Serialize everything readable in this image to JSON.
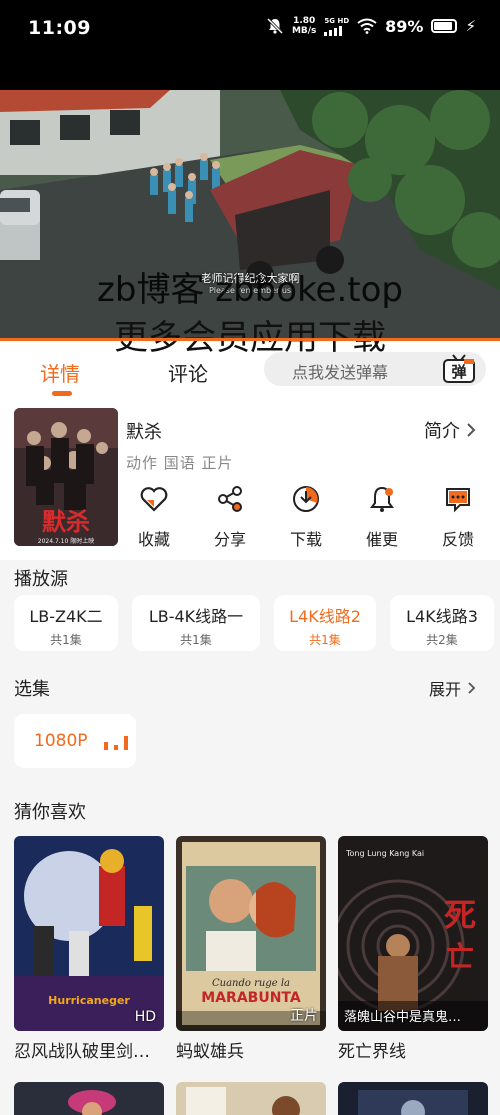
{
  "status_bar": {
    "time": "11:09",
    "net_speed": "1.80",
    "net_unit": "MB/s",
    "net_type": "5G HD",
    "battery": "89%"
  },
  "video": {
    "watermark_line1": "zb博客 zbboke.top",
    "watermark_line2": "更多会员应用下载",
    "subtitle_cn": "老师记得纪念大家啊",
    "subtitle_en": "Please remember us"
  },
  "tabs": [
    {
      "label": "详情"
    },
    {
      "label": "评论"
    }
  ],
  "danmu": {
    "placeholder": "点我发送弹幕",
    "button_label": "弹"
  },
  "movie": {
    "title": "默杀",
    "tags": "动作 国语 正片",
    "intro_label": "简介",
    "poster_text": "默杀",
    "poster_sub": "2024.7.10 限时上映"
  },
  "actions": [
    {
      "label": "收藏",
      "icon": "heart-icon"
    },
    {
      "label": "分享",
      "icon": "share-icon"
    },
    {
      "label": "下载",
      "icon": "download-icon"
    },
    {
      "label": "催更",
      "icon": "bell-icon"
    },
    {
      "label": "反馈",
      "icon": "feedback-icon"
    }
  ],
  "source": {
    "title": "播放源",
    "items": [
      {
        "name": "LB-Z4K二",
        "count": "共1集"
      },
      {
        "name": "LB-4K线路一",
        "count": "共1集"
      },
      {
        "name": "L4K线路2",
        "count": "共1集"
      },
      {
        "name": "L4K线路3",
        "count": "共2集"
      }
    ],
    "active_index": 2
  },
  "episodes": {
    "title": "选集",
    "expand_label": "展开",
    "items": [
      {
        "label": "1080P"
      }
    ]
  },
  "recommend": {
    "title": "猜你喜欢",
    "items": [
      {
        "name": "忍风战队破里剑…",
        "badge": "HD",
        "poster_text": "Hurricaneger"
      },
      {
        "name": "蚂蚁雄兵",
        "badge": "正片",
        "poster_text": "Cuando ruge la MARABUNTA"
      },
      {
        "name": "死亡界线",
        "badge": "落魄山谷中是真鬼…",
        "poster_text": "死亡界"
      }
    ]
  },
  "colors": {
    "accent": "#f26b1d",
    "background": "#f5f5f5"
  }
}
